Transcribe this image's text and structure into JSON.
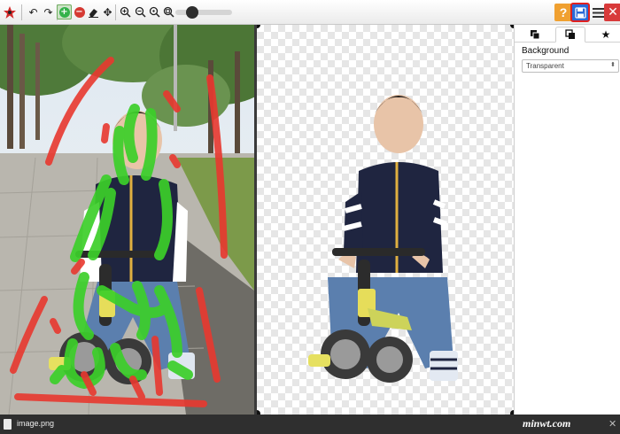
{
  "panel": {
    "title": "Background",
    "select_value": "Transparent"
  },
  "download": {
    "file_name": "image.png"
  },
  "toolbar": {
    "help_label": "?"
  },
  "watermark": "minwt.com",
  "icons": {
    "app_logo": "app-logo-icon",
    "undo": "undo-icon",
    "redo": "redo-icon",
    "keep": "plus-circle-icon",
    "remove": "minus-circle-icon",
    "eraser": "eraser-icon",
    "move": "move-icon",
    "zoom_in": "zoom-in-icon",
    "zoom_out": "zoom-out-icon",
    "zoom_reset": "zoom-reset-icon",
    "zoom_fit": "zoom-fit-icon",
    "help": "help-icon",
    "save": "save-icon",
    "menu": "menu-icon",
    "close": "close-icon"
  },
  "colors": {
    "keep_marker": "#3ccf2a",
    "remove_marker": "#e8382f",
    "help_button": "#f0a030",
    "save_button": "#2a6ad8",
    "close_button": "#d83a3a",
    "save_highlight": "#e02020"
  }
}
